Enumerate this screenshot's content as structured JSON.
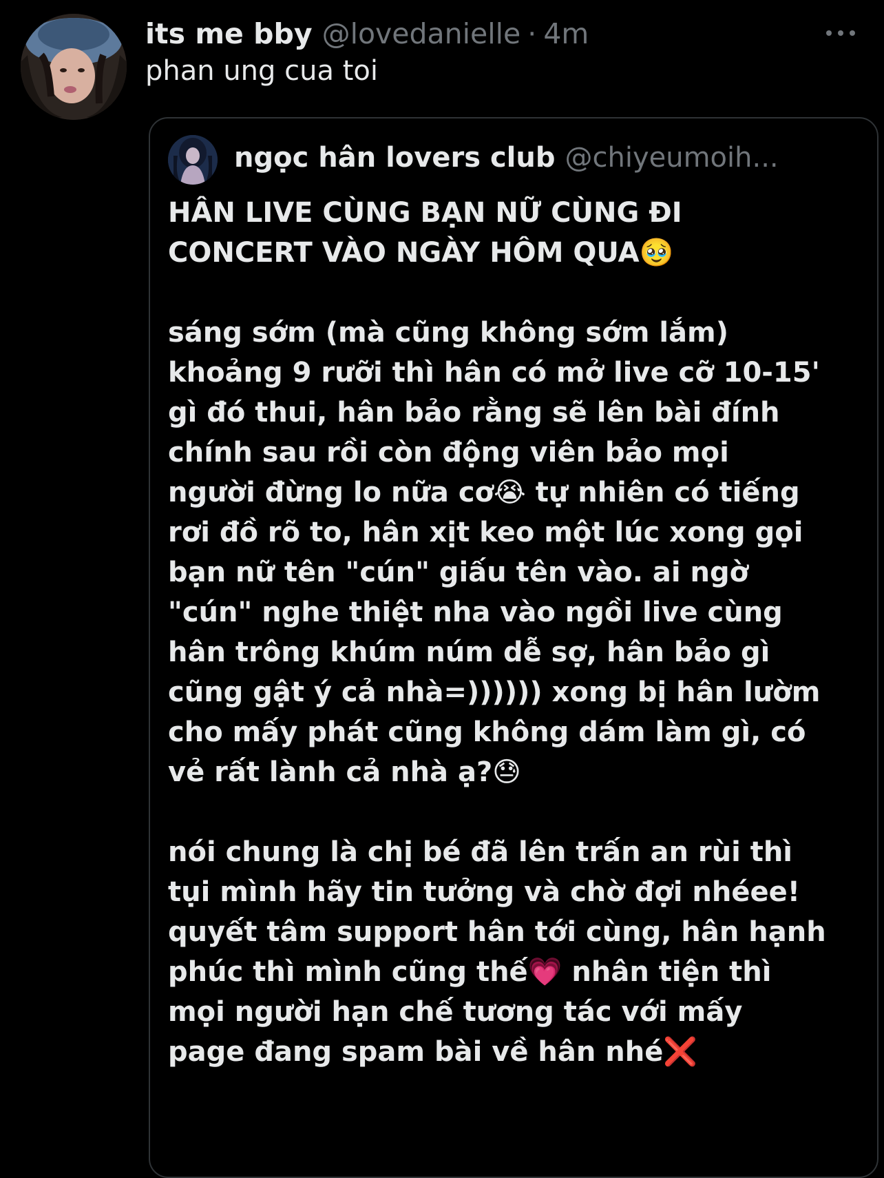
{
  "tweet": {
    "avatar_icon": "profile-photo",
    "display_name": "its me bby",
    "handle": "@lovedanielle",
    "separator": "·",
    "timestamp": "4m",
    "more_icon": "more-horizontal-icon",
    "text": "phan ung cua toi"
  },
  "quote": {
    "avatar_icon": "profile-photo",
    "display_name": "ngọc hân lovers club",
    "handle": "@chiyeumoih...",
    "lines": [
      "HÂN LIVE CÙNG BẠN NỮ CÙNG ĐI",
      "CONCERT VÀO NGÀY HÔM QUA🥹",
      "",
      "sáng sớm (mà cũng không sớm lắm)",
      "khoảng 9 rưỡi thì hân có mở live cỡ 10-15'",
      "gì đó thui, hân bảo rằng sẽ lên bài đính",
      "chính sau rồi còn động viên bảo mọi",
      "người đừng lo nữa cơ😭  tự nhiên có tiếng",
      "rơi đồ rõ to, hân xịt keo một lúc xong gọi",
      "bạn nữ tên \"cún\" giấu tên vào. ai ngờ",
      "\"cún\" nghe thiệt nha vào ngồi live cùng",
      "hân trông khúm núm dễ sợ, hân bảo gì",
      "cũng gật ý cả nhà=)))))) xong bị hân lườm",
      "cho mấy phát cũng không dám làm gì, có",
      "vẻ rất lành cả nhà ạ?😓",
      "",
      "nói chung là chị bé đã lên trấn an rùi thì",
      "tụi mình hãy tin tưởng và chờ đợi nhéee!",
      "quyết tâm support hân tới cùng, hân hạnh",
      "phúc thì mình cũng thế💗 nhân tiện thì",
      "mọi người hạn chế tương tác với mấy",
      "page đang spam bài về hân nhé❌"
    ]
  },
  "colors": {
    "background": "#000000",
    "primary_text": "#e7e9ea",
    "secondary_text": "#71767b",
    "border": "#2f3336"
  }
}
